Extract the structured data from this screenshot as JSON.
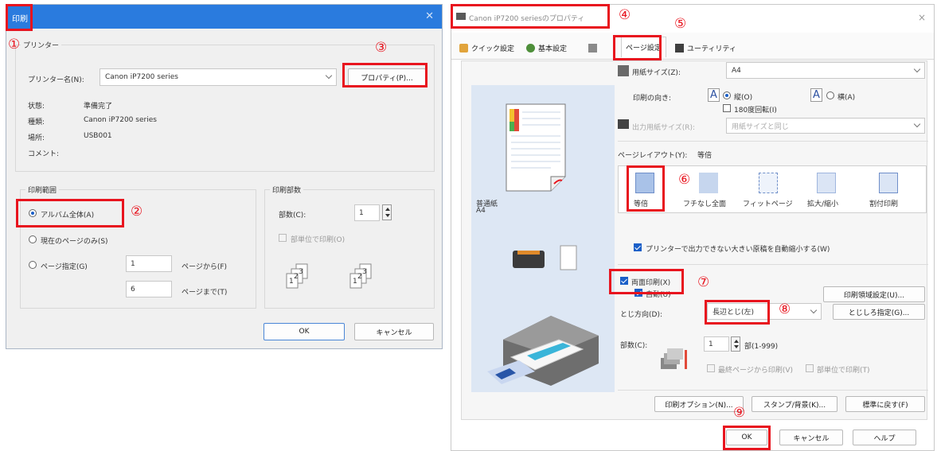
{
  "print_dialog": {
    "title": "印刷",
    "printer_group": "プリンター",
    "printer_name_label": "プリンター名(N):",
    "printer_name_value": "Canon iP7200 series",
    "properties_button": "プロパティ(P)...",
    "status_label": "状態:",
    "status_value": "準備完了",
    "type_label": "種類:",
    "type_value": "Canon iP7200 series",
    "where_label": "場所:",
    "where_value": "USB001",
    "comment_label": "コメント:",
    "range_group": "印刷範囲",
    "range_all": "アルバム全体(A)",
    "range_current": "現在のページのみ(S)",
    "range_pages": "ページ指定(G)",
    "page_from_value": "1",
    "page_from_label": "ページから(F)",
    "page_to_value": "6",
    "page_to_label": "ページまで(T)",
    "copies_group": "印刷部数",
    "copies_label": "部数(C):",
    "copies_value": "1",
    "collate_label": "部単位で印刷(O)",
    "ok": "OK",
    "cancel": "キャンセル"
  },
  "props_dialog": {
    "title": "Canon iP7200 seriesのプロパティ",
    "tabs": [
      "クイック設定",
      "基本設定",
      "ページ設定",
      "ユーティリティ"
    ],
    "paper_size_label": "用紙サイズ(Z):",
    "paper_size_value": "A4",
    "orientation_label": "印刷の向き:",
    "portrait": "縦(O)",
    "landscape": "横(A)",
    "rotate_label": "180度回転(I)",
    "output_size_label": "出力用紙サイズ(R):",
    "output_size_value": "用紙サイズと同じ",
    "page_layout_label": "ページレイアウト(Y):",
    "page_layout_value": "等倍",
    "layouts": [
      "等倍",
      "フチなし全面",
      "フィットページ",
      "拡大/縮小",
      "割付印刷"
    ],
    "preview_paper": "普通紙",
    "preview_size": "A4",
    "auto_fit_label": "プリンターで出力できない大きい原稿を自動縮小する(W)",
    "duplex_label": "両面印刷(X)",
    "duplex_sub": "自動(U)",
    "margin_button": "印刷領域設定(U)...",
    "binding_label": "とじ方向(D):",
    "binding_value": "長辺とじ(左)",
    "binding_margin_button": "とじしろ指定(G)...",
    "copies_label": "部数(C):",
    "copies_value": "1",
    "copies_range": "部(1-999)",
    "last_page_first": "最終ページから印刷(V)",
    "collate": "部単位で印刷(T)",
    "print_options_button": "印刷オプション(N)...",
    "stamp_button": "スタンプ/背景(K)...",
    "defaults_button": "標準に戻す(F)",
    "ok": "OK",
    "cancel": "キャンセル",
    "help": "ヘルプ"
  },
  "callouts": [
    "①",
    "②",
    "③",
    "④",
    "⑤",
    "⑥",
    "⑦",
    "⑧",
    "⑨"
  ],
  "colors": {
    "annotation_red": "#e8141e",
    "titlebar_blue": "#2a7bde",
    "radio_blue": "#1a5fc8"
  }
}
